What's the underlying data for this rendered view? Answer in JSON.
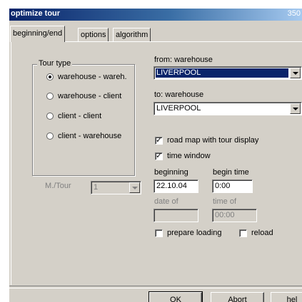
{
  "window": {
    "title": "optimize tour",
    "title_right": "350"
  },
  "tabs": [
    "beginning/end",
    "options",
    "algorithm"
  ],
  "tour_type": {
    "title": "Tour type",
    "options": [
      "warehouse - wareh.",
      "warehouse - client",
      "client - client",
      "client - warehouse"
    ],
    "selected": 0
  },
  "from": {
    "label": "from: warehouse",
    "value": "LIVERPOOL"
  },
  "to": {
    "label": "to: warehouse",
    "value": "LIVERPOOL"
  },
  "road_map": {
    "label": "road map with tour display",
    "checked": true
  },
  "time_window": {
    "label": "time window",
    "checked": true
  },
  "beginning": {
    "label": "beginning",
    "value": "22.10.04"
  },
  "begin_time": {
    "label": "begin time",
    "value": "0:00"
  },
  "date_of": {
    "label": "date of",
    "value": ""
  },
  "time_of": {
    "label": "time of",
    "value": "00:00"
  },
  "prepare_loading": {
    "label": "prepare loading",
    "checked": false
  },
  "reload": {
    "label": "reload",
    "checked": false
  },
  "m_tour": {
    "label": "M./Tour",
    "value": "1"
  },
  "buttons": {
    "ok": "OK",
    "abort": "Abort",
    "help": "hel"
  }
}
